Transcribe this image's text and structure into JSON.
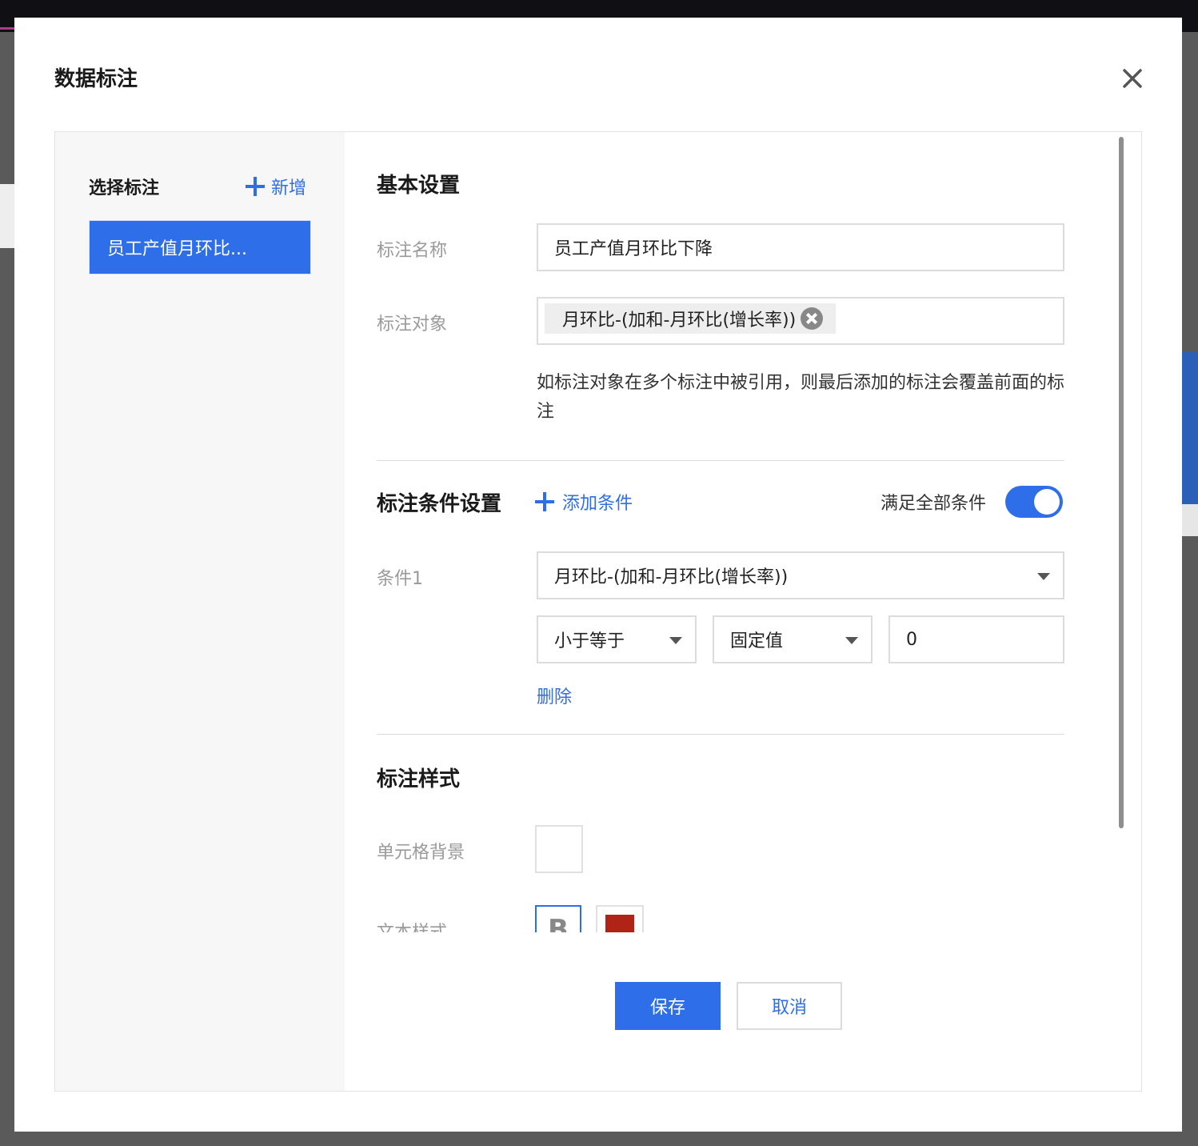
{
  "dialog": {
    "title": "数据标注"
  },
  "sidebar": {
    "title": "选择标注",
    "add_label": "新增",
    "items": [
      {
        "label": "员工产值月环比..."
      }
    ]
  },
  "basic": {
    "section_title": "基本设置",
    "name_label": "标注名称",
    "name_value": "员工产值月环比下降",
    "target_label": "标注对象",
    "target_tag": "月环比-(加和-月环比(增长率))",
    "hint": "如标注对象在多个标注中被引用，则最后添加的标注会覆盖前面的标注"
  },
  "conditions": {
    "section_title": "标注条件设置",
    "add_label": "添加条件",
    "match_all_label": "满足全部条件",
    "match_all_on": true,
    "items": [
      {
        "label": "条件1",
        "field": "月环比-(加和-月环比(增长率))",
        "operator": "小于等于",
        "value_type": "固定值",
        "value": "0",
        "delete_label": "删除"
      }
    ]
  },
  "style": {
    "section_title": "标注样式",
    "cell_bg_label": "单元格背景",
    "text_style_label": "文本样式",
    "bold_label": "B",
    "text_color": "#b02418"
  },
  "footer": {
    "save_label": "保存",
    "cancel_label": "取消"
  },
  "colors": {
    "accent": "#2e6ee8"
  }
}
